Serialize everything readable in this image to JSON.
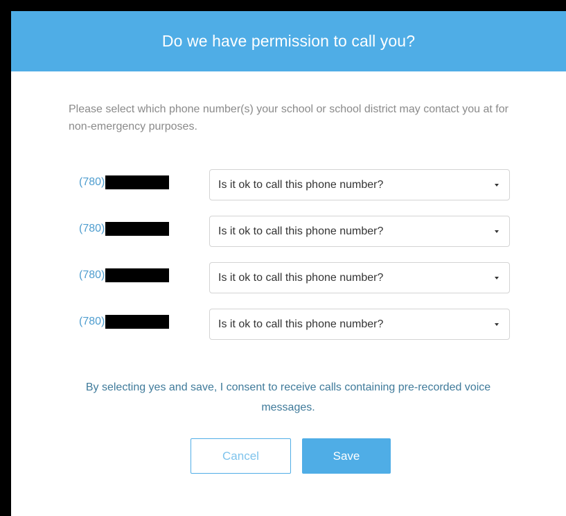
{
  "modal": {
    "title": "Do we have permission to call you?",
    "intro": "Please select which phone number(s) your school or school district may contact you at for non-emergency purposes.",
    "consent": "By selecting yes and save, I consent to receive calls containing pre-recorded voice messages."
  },
  "phones": [
    {
      "area_code": "(780)",
      "select_placeholder": "Is it ok to call this phone number?"
    },
    {
      "area_code": "(780)",
      "select_placeholder": "Is it ok to call this phone number?"
    },
    {
      "area_code": "(780)",
      "select_placeholder": "Is it ok to call this phone number?"
    },
    {
      "area_code": "(780)",
      "select_placeholder": "Is it ok to call this phone number?"
    }
  ],
  "buttons": {
    "cancel_label": "Cancel",
    "save_label": "Save"
  },
  "colors": {
    "accent": "#4fade6",
    "area_code": "#4e9dcf",
    "consent_text": "#3f7a9a",
    "intro_text": "#8a8a8a"
  },
  "icons": {
    "select_caret": "caret-down-icon"
  }
}
